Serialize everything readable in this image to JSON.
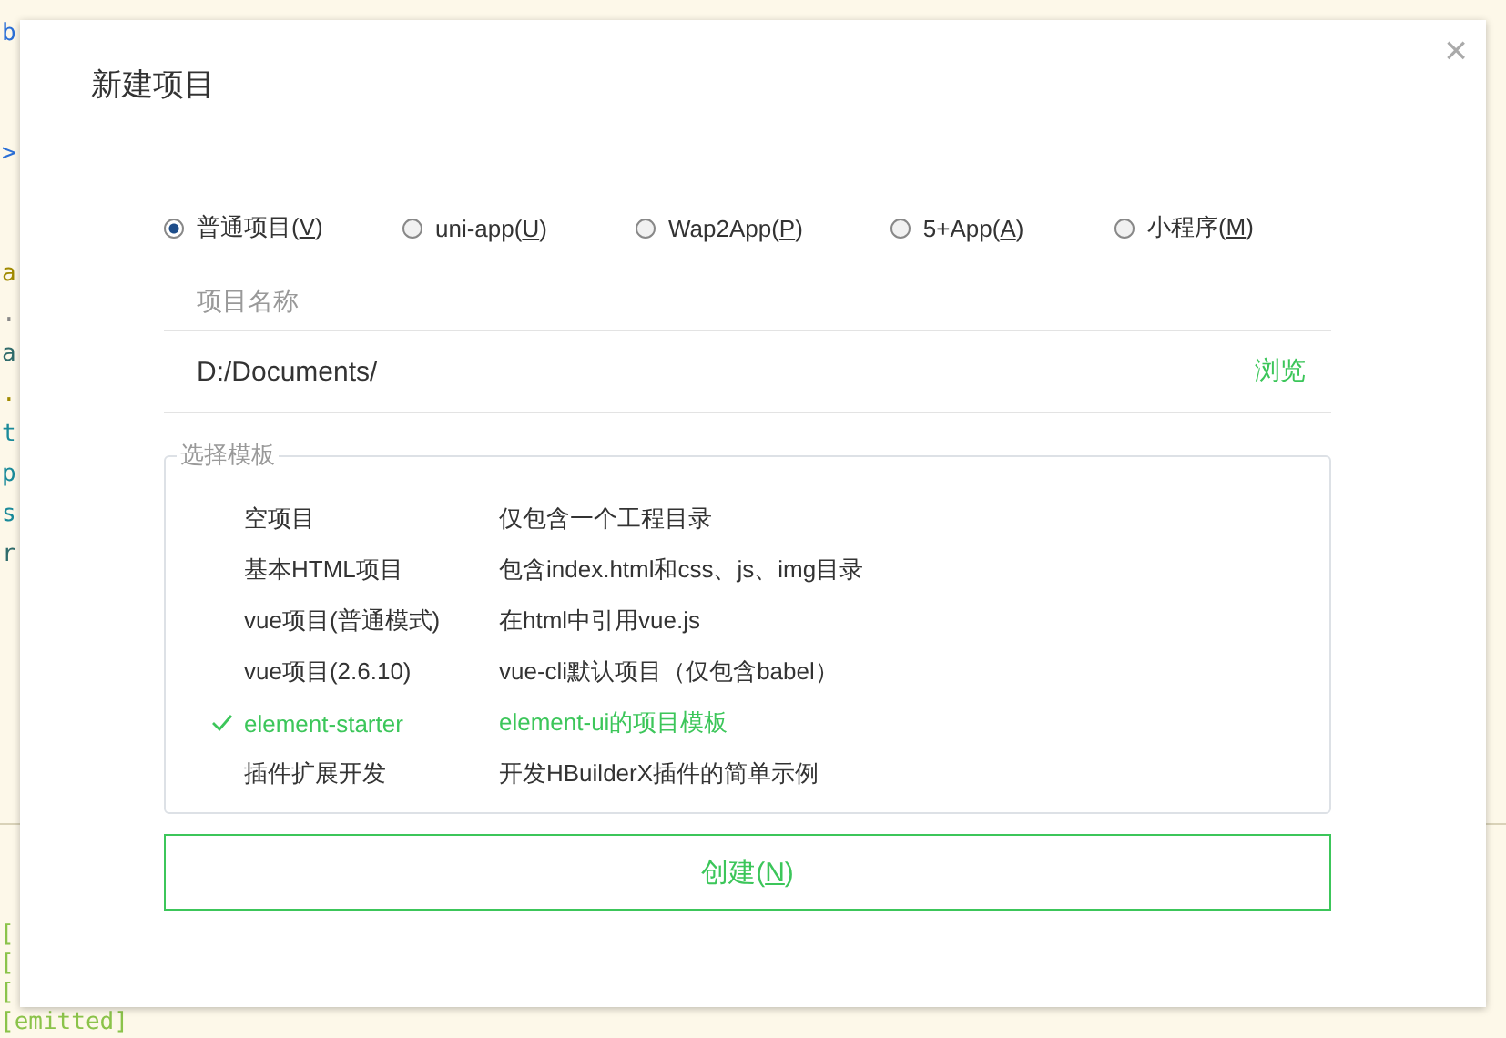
{
  "editor_lines": [
    {
      "text": "b",
      "color": "#2b6fd6"
    },
    {
      "text": ">",
      "color": "#2b6fd6"
    },
    {
      "text": "a",
      "color": "#a08a00"
    },
    {
      "text": ".",
      "color": "#888888"
    },
    {
      "text": "a",
      "color": "#2f6b6b"
    },
    {
      "text": ".",
      "color": "#a08a00"
    },
    {
      "text": "t",
      "color": "#1a8a9a"
    },
    {
      "text": "p",
      "color": "#1a8a9a"
    },
    {
      "text": "s",
      "color": "#1a8a9a"
    },
    {
      "text": "r",
      "color": "#2f6b6b"
    }
  ],
  "console_lines": [
    {
      "text": "["
    },
    {
      "text": "["
    },
    {
      "text": "["
    },
    {
      "text": "[emitted]"
    }
  ],
  "dialog": {
    "title": "新建项目",
    "close": "×",
    "project_types": [
      {
        "label": "普通项目(",
        "hotkey": "V",
        "after": ")",
        "selected": true
      },
      {
        "label": "uni-app(",
        "hotkey": "U",
        "after": ")",
        "selected": false
      },
      {
        "label": "Wap2App(",
        "hotkey": "P",
        "after": ")",
        "selected": false
      },
      {
        "label": "5+App(",
        "hotkey": "A",
        "after": ")",
        "selected": false
      },
      {
        "label": "小程序(",
        "hotkey": "M",
        "after": ")",
        "selected": false
      }
    ],
    "name_field": {
      "placeholder": "项目名称"
    },
    "path_field": {
      "value": "D:/Documents/",
      "browse": "浏览"
    },
    "templates": {
      "legend": "选择模板",
      "rows": [
        {
          "name": "空项目",
          "description": "仅包含一个工程目录",
          "selected": false
        },
        {
          "name": "基本HTML项目",
          "description": "包含index.html和css、js、img目录",
          "selected": false
        },
        {
          "name": "vue项目(普通模式)",
          "description": "在html中引用vue.js",
          "selected": false
        },
        {
          "name": "vue项目(2.6.10)",
          "description": "vue-cli默认项目（仅包含babel）",
          "selected": false
        },
        {
          "name": "element-starter",
          "description": "element-ui的项目模板",
          "selected": true
        },
        {
          "name": "插件扩展开发",
          "description": "开发HBuilderX插件的简单示例",
          "selected": false
        }
      ]
    },
    "create_button": {
      "label": "创建(",
      "hotkey": "N",
      "after": ")"
    }
  }
}
